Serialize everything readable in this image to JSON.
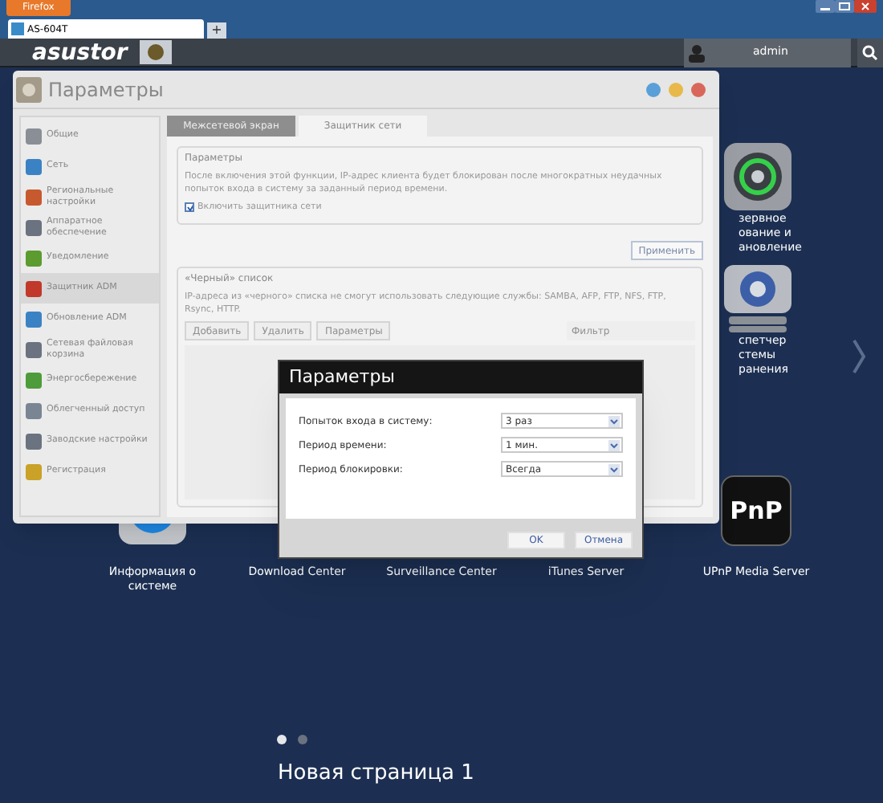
{
  "browser": {
    "menu_button": "Firefox",
    "tab_title": "AS-604T",
    "new_tab": "+"
  },
  "topbar": {
    "logo": "asustor",
    "user": "admin"
  },
  "settings_window": {
    "title": "Параметры",
    "sidebar": [
      {
        "label": "Общие",
        "selected": false
      },
      {
        "label": "Сеть",
        "selected": false
      },
      {
        "label": "Региональные настройки",
        "selected": false
      },
      {
        "label": "Аппаратное обеспечение",
        "selected": false
      },
      {
        "label": "Уведомление",
        "selected": false
      },
      {
        "label": "Защитник ADM",
        "selected": true
      },
      {
        "label": "Обновление ADM",
        "selected": false
      },
      {
        "label": "Сетевая файловая корзина",
        "selected": false
      },
      {
        "label": "Энергосбережение",
        "selected": false
      },
      {
        "label": "Облегченный доступ",
        "selected": false
      },
      {
        "label": "Заводские настройки",
        "selected": false
      },
      {
        "label": "Регистрация",
        "selected": false
      }
    ],
    "tabs": [
      {
        "label": "Межсетевой экран",
        "selected": false
      },
      {
        "label": "Защитник сети",
        "selected": true
      }
    ],
    "params": {
      "legend": "Параметры",
      "text": "После включения этой функции, IP-адрес клиента будет блокирован после многократных неудачных попыток входа в систему за заданный период времени.",
      "checkbox": {
        "label": "Включить защитника сети",
        "checked": true
      }
    },
    "apply_button": "Применить",
    "blacklist": {
      "legend": "«Черный» список",
      "text": "IP-адреса из «черного» списка не смогут использовать следующие службы: SAMBA, AFP, FTP, NFS, FTP, Rsync, HTTP.",
      "buttons": [
        {
          "label": "Добавить",
          "disabled": true
        },
        {
          "label": "Удалить",
          "disabled": true
        },
        {
          "label": "Параметры",
          "disabled": true
        }
      ],
      "filter_placeholder": "Фильтр"
    }
  },
  "dialog": {
    "title": "Параметры",
    "rows": [
      {
        "label": "Попыток входа в систему:",
        "value": "3 раз"
      },
      {
        "label": "Период времени:",
        "value": "1 мин."
      },
      {
        "label": "Период блокировки:",
        "value": "Всегда"
      }
    ],
    "buttons": [
      "OK",
      "Отмена"
    ]
  },
  "desktop": {
    "right_icons": [
      {
        "kind": "disc",
        "label_lines": [
          "зервное",
          "ование и",
          "ановление"
        ]
      },
      {
        "kind": "drive",
        "label_lines": [
          "спетчер",
          "стемы",
          "ранения"
        ]
      }
    ],
    "upnp_mark": "PnP",
    "bottom_icons": [
      {
        "kind": "info",
        "label": "Информация о системе"
      },
      {
        "label": "Download Center"
      },
      {
        "label": "Surveillance Center"
      },
      {
        "label": "iTunes Server"
      },
      {
        "kind": "upnp",
        "label": "UPnP Media Server"
      }
    ],
    "pages": [
      {
        "selected": true
      },
      {
        "selected": false
      }
    ],
    "page_title": "Новая страница 1"
  }
}
